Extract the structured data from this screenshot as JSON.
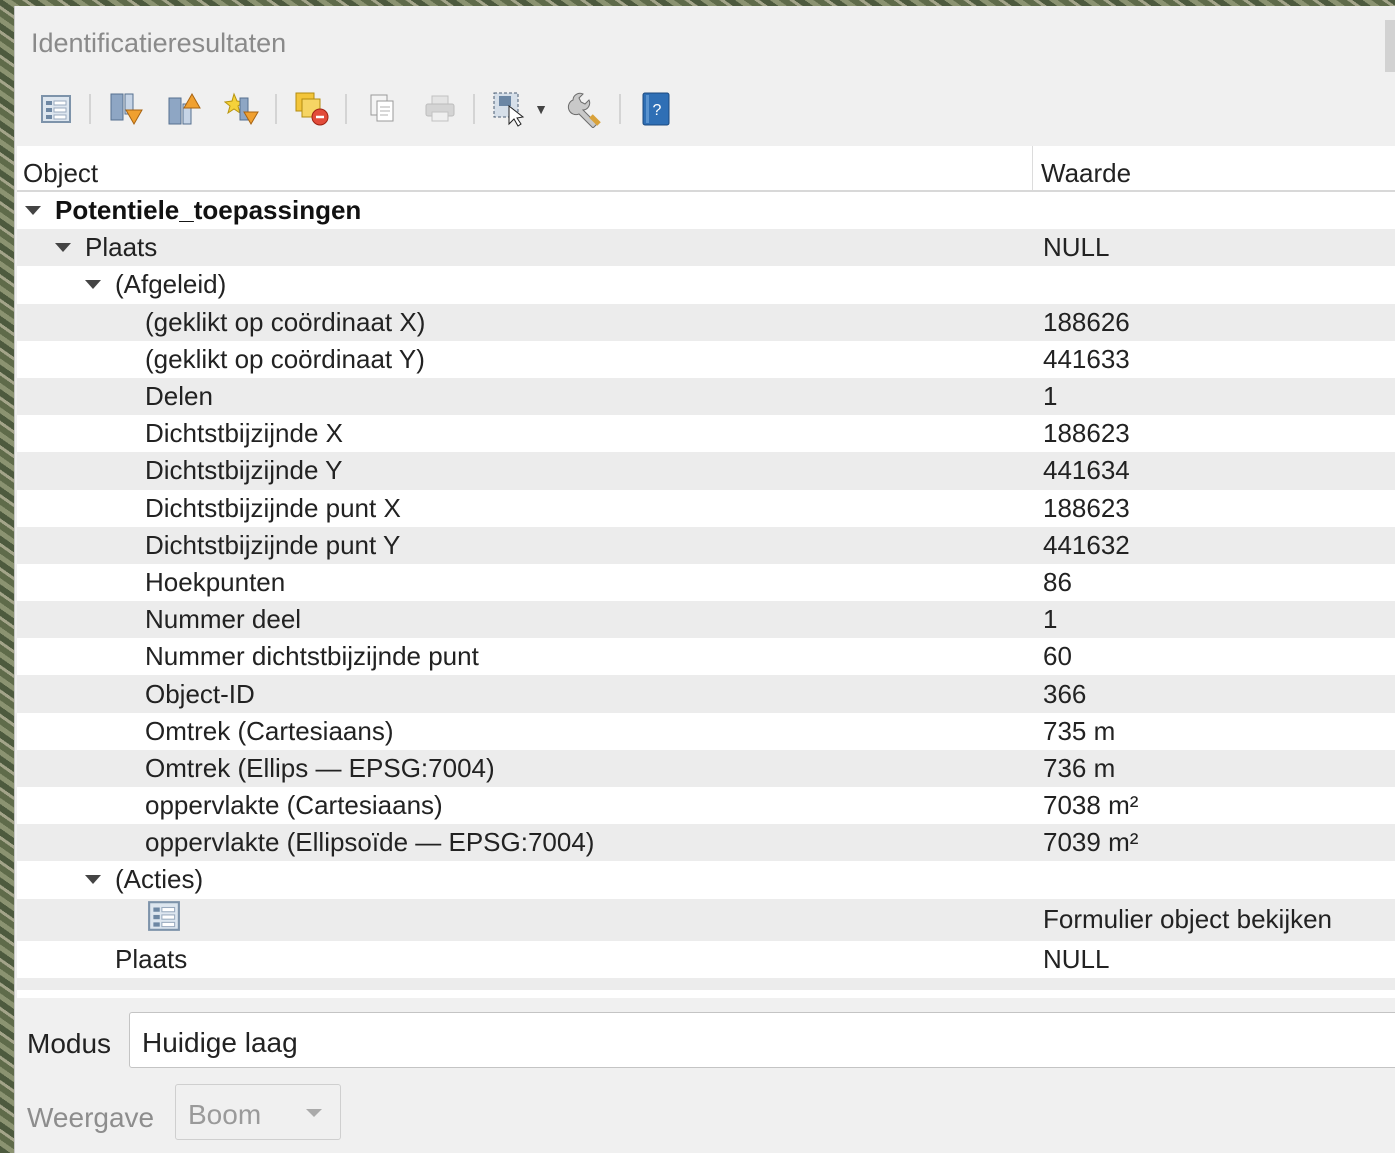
{
  "window": {
    "title": "Identificatieresultaten"
  },
  "toolbar": {
    "buttons": [
      {
        "name": "expand-all-tree",
        "icon": "form-view-icon"
      },
      {
        "name": "expand-tree",
        "icon": "expand-down-icon"
      },
      {
        "name": "collapse-tree",
        "icon": "collapse-up-icon"
      },
      {
        "name": "expand-new-results",
        "icon": "expand-new-icon"
      },
      {
        "name": "clear-results",
        "icon": "clear-highlight-icon"
      },
      {
        "name": "copy-feature",
        "icon": "copy-icon"
      },
      {
        "name": "print",
        "icon": "print-icon"
      },
      {
        "name": "identify-select",
        "icon": "identify-select-icon"
      },
      {
        "name": "settings",
        "icon": "wrench-icon"
      },
      {
        "name": "help",
        "icon": "help-icon"
      }
    ]
  },
  "table": {
    "col_object": "Object",
    "col_value": "Waarde",
    "layer": "Potentiele_toepassingen",
    "feature_label": "Plaats",
    "feature_value": "NULL",
    "derived_label": "(Afgeleid)",
    "derived": [
      {
        "label": "(geklikt op coördinaat X)",
        "value": "188626"
      },
      {
        "label": "(geklikt op coördinaat Y)",
        "value": "441633"
      },
      {
        "label": "Delen",
        "value": "1"
      },
      {
        "label": "Dichtstbijzijnde X",
        "value": "188623"
      },
      {
        "label": "Dichtstbijzijnde Y",
        "value": "441634"
      },
      {
        "label": "Dichtstbijzijnde punt X",
        "value": "188623"
      },
      {
        "label": "Dichtstbijzijnde punt Y",
        "value": "441632"
      },
      {
        "label": "Hoekpunten",
        "value": "86"
      },
      {
        "label": "Nummer deel",
        "value": "1"
      },
      {
        "label": "Nummer dichtstbijzijnde punt",
        "value": "60"
      },
      {
        "label": "Object-ID",
        "value": "366"
      },
      {
        "label": "Omtrek (Cartesiaans)",
        "value": "735 m"
      },
      {
        "label": "Omtrek (Ellips — EPSG:7004)",
        "value": "736 m"
      },
      {
        "label": "oppervlakte (Cartesiaans)",
        "value": "7038 m²"
      },
      {
        "label": "oppervlakte (Ellipsoïde — EPSG:7004)",
        "value": "7039 m²"
      }
    ],
    "actions_label": "(Acties)",
    "action_value": "Formulier object bekijken",
    "attr_label": "Plaats",
    "attr_value": "NULL"
  },
  "bottom": {
    "modus_label": "Modus",
    "modus_value": "Huidige laag",
    "weergave_label": "Weergave",
    "weergave_value": "Boom"
  }
}
